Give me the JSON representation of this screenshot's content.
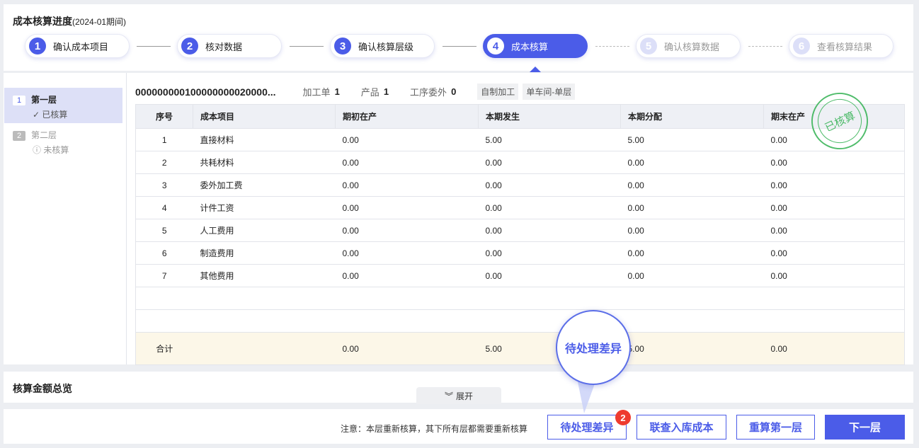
{
  "header": {
    "title": "成本核算进度",
    "period": "(2024-01期间)"
  },
  "steps": [
    {
      "num": "1",
      "label": "确认成本项目"
    },
    {
      "num": "2",
      "label": "核对数据"
    },
    {
      "num": "3",
      "label": "确认核算层级"
    },
    {
      "num": "4",
      "label": "成本核算"
    },
    {
      "num": "5",
      "label": "确认核算数据"
    },
    {
      "num": "6",
      "label": "查看核算结果"
    }
  ],
  "layers": [
    {
      "num": "1",
      "name": "第一层",
      "status": "✓ 已核算"
    },
    {
      "num": "2",
      "name": "第二层",
      "status": "ⓘ 未核算"
    }
  ],
  "info": {
    "code": "000000000100000000020000...",
    "order_label": "加工单",
    "order": "1",
    "product_label": "产品",
    "product": "1",
    "outsource_label": "工序委外",
    "outsource": "0",
    "tags": [
      "自制加工",
      "单车间-单层"
    ]
  },
  "table": {
    "headers": [
      "序号",
      "成本项目",
      "期初在产",
      "本期发生",
      "本期分配",
      "期末在产"
    ],
    "rows": [
      [
        "1",
        "直接材料",
        "0.00",
        "5.00",
        "5.00",
        "0.00"
      ],
      [
        "2",
        "共耗材料",
        "0.00",
        "0.00",
        "0.00",
        "0.00"
      ],
      [
        "3",
        "委外加工费",
        "0.00",
        "0.00",
        "0.00",
        "0.00"
      ],
      [
        "4",
        "计件工资",
        "0.00",
        "0.00",
        "0.00",
        "0.00"
      ],
      [
        "5",
        "人工费用",
        "0.00",
        "0.00",
        "0.00",
        "0.00"
      ],
      [
        "6",
        "制造费用",
        "0.00",
        "0.00",
        "0.00",
        "0.00"
      ],
      [
        "7",
        "其他费用",
        "0.00",
        "0.00",
        "0.00",
        "0.00"
      ]
    ],
    "total": [
      "合计",
      "",
      "0.00",
      "5.00",
      "5.00",
      "0.00"
    ]
  },
  "stamp": "已核算",
  "overview": {
    "title": "核算金额总览",
    "expand": "展开"
  },
  "footer": {
    "note": "注意：本层重新核算，其下所有层都需要重新核算",
    "pending": "待处理差异",
    "pending_count": "2",
    "query": "联查入库成本",
    "recalc": "重算第一层",
    "next": "下一层"
  },
  "callout": "待处理差异"
}
